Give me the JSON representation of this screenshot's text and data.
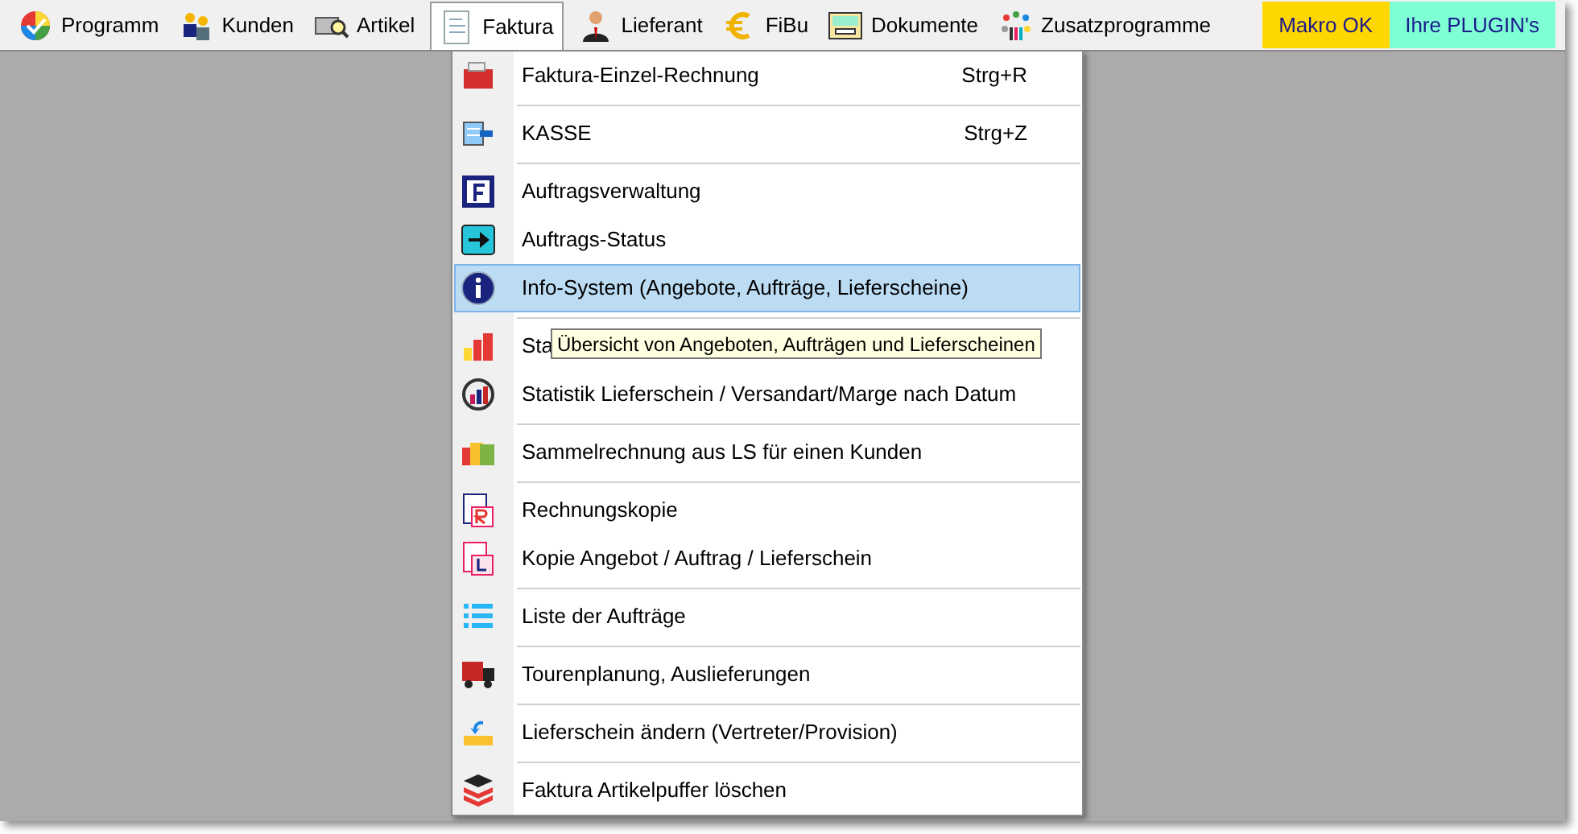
{
  "menubar": [
    {
      "label": "Programm",
      "selected": false
    },
    {
      "label": "Kunden",
      "selected": false
    },
    {
      "label": "Artikel",
      "selected": false
    },
    {
      "label": "Faktura",
      "selected": true
    },
    {
      "label": "Lieferant",
      "selected": false
    },
    {
      "label": "FiBu",
      "selected": false
    },
    {
      "label": "Dokumente",
      "selected": false
    },
    {
      "label": "Zusatzprogramme",
      "selected": false
    }
  ],
  "status_buttons": [
    {
      "label": "Makro OK",
      "color": "#ffd700"
    },
    {
      "label": "Ihre PLUGIN's",
      "color": "#7fffd4"
    }
  ],
  "menu": {
    "groups": [
      [
        {
          "label": "Faktura-Einzel-Rechnung",
          "shortcut": "Strg+R",
          "selected": false
        }
      ],
      [
        {
          "label": "KASSE",
          "shortcut": "Strg+Z",
          "selected": false
        }
      ],
      [
        {
          "label": "Auftragsverwaltung",
          "selected": false
        },
        {
          "label": "Auftrags-Status",
          "selected": false
        },
        {
          "label": "Info-System (Angebote, Aufträge, Lieferscheine)",
          "selected": true
        }
      ],
      [
        {
          "label": "Sta",
          "selected": false
        },
        {
          "label": "Statistik Lieferschein / Versandart/Marge nach Datum",
          "selected": false
        }
      ],
      [
        {
          "label": "Sammelrechnung aus LS für einen Kunden",
          "selected": false
        }
      ],
      [
        {
          "label": "Rechnungskopie",
          "selected": false
        },
        {
          "label": "Kopie Angebot / Auftrag / Lieferschein",
          "selected": false
        }
      ],
      [
        {
          "label": "Liste der Aufträge",
          "selected": false
        }
      ],
      [
        {
          "label": "Tourenplanung, Auslieferungen",
          "selected": false
        }
      ],
      [
        {
          "label": "Lieferschein ändern (Vertreter/Provision)",
          "selected": false
        }
      ],
      [
        {
          "label": "Faktura Artikelpuffer löschen",
          "selected": false
        }
      ]
    ]
  },
  "tooltip": {
    "text": "Übersicht von Angeboten, Aufträgen und Lieferscheinen"
  }
}
